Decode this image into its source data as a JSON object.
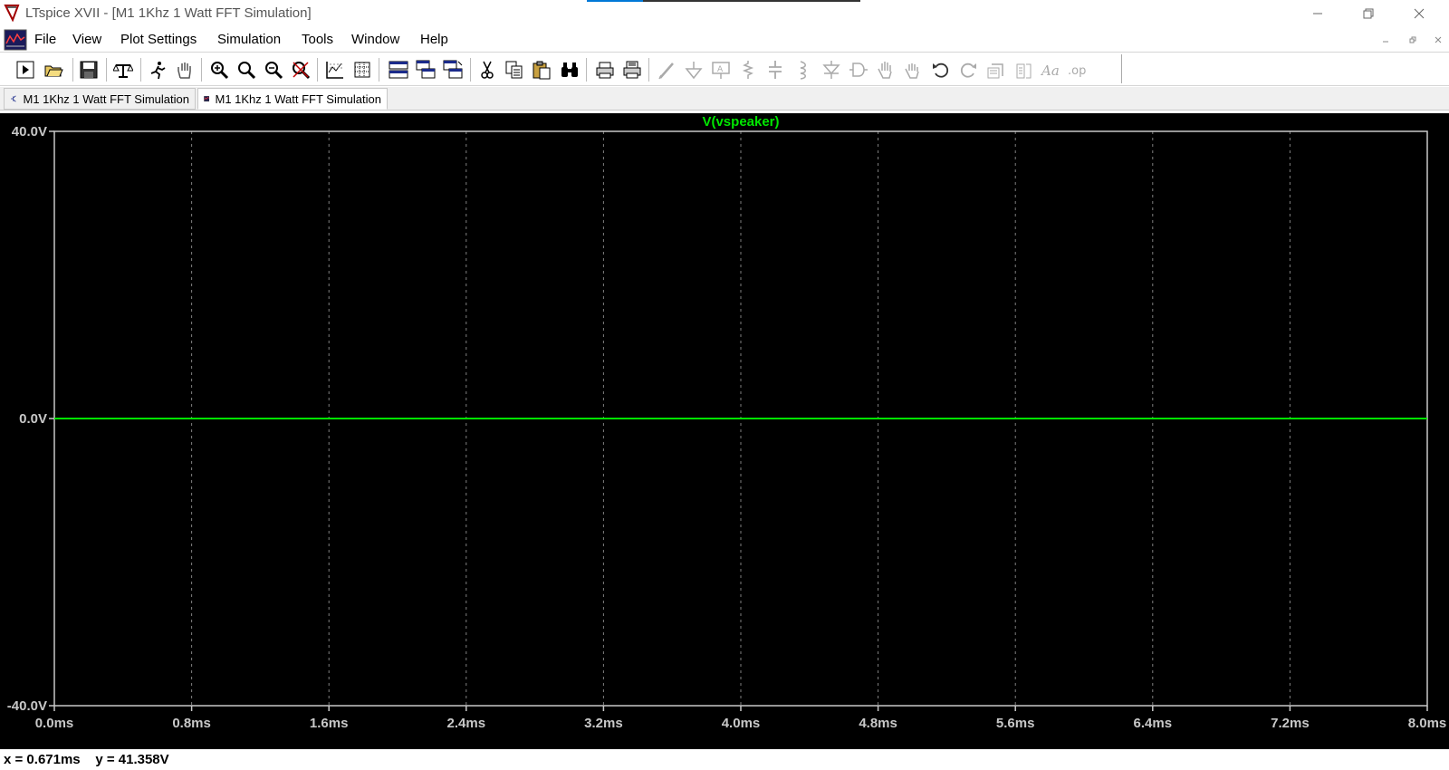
{
  "window": {
    "title": "LTspice XVII - [M1 1Khz 1 Watt FFT Simulation]"
  },
  "menu": {
    "items": [
      "File",
      "View",
      "Plot Settings",
      "Simulation",
      "Tools",
      "Window",
      "Help"
    ]
  },
  "toolbar": {
    "icons": [
      "run-icon",
      "open-icon",
      "save-icon",
      "control-panel-icon",
      "run-stop-icon",
      "pan-hand-icon",
      "zoom-in-icon",
      "zoom-out-icon",
      "zoom-back-icon",
      "zoom-cancel-icon",
      "autorange-icon",
      "grid-icon",
      "tile-horizontal-icon",
      "cascade-icon",
      "tile-vertical-icon",
      "cut-icon",
      "copy-icon",
      "paste-icon",
      "find-icon",
      "print-icon",
      "print-setup-icon",
      "wire-icon",
      "ground-icon",
      "label-icon",
      "resistor-icon",
      "capacitor-icon",
      "inductor-icon",
      "diode-icon",
      "component-icon",
      "move-icon",
      "drag-icon",
      "undo-icon",
      "redo-icon",
      "rotate-icon",
      "mirror-icon",
      "text-icon",
      "spice-directive-icon"
    ]
  },
  "tabs": [
    {
      "label": "M1 1Khz 1 Watt FFT Simulation",
      "kind": "schematic"
    },
    {
      "label": "M1 1Khz 1 Watt FFT Simulation",
      "kind": "waveform"
    }
  ],
  "status": {
    "cursor": "x = 0.671ms    y = 41.358V"
  },
  "colors": {
    "plot_background": "#000000",
    "trace": "#00e600",
    "grid": "#808080",
    "axis": "#c8c8c8"
  },
  "chart_data": {
    "type": "line",
    "title": "",
    "series": [
      {
        "name": "V(vspeaker)",
        "x": [
          0.0,
          8.0
        ],
        "y": [
          0.0,
          0.0
        ]
      }
    ],
    "xlim": [
      0.0,
      8.0
    ],
    "ylim": [
      -40.0,
      40.0
    ],
    "xticks": [
      0.0,
      0.8,
      1.6,
      2.4,
      3.2,
      4.0,
      4.8,
      5.6,
      6.4,
      7.2,
      8.0
    ],
    "xtick_labels": [
      "0.0ms",
      "0.8ms",
      "1.6ms",
      "2.4ms",
      "3.2ms",
      "4.0ms",
      "4.8ms",
      "5.6ms",
      "6.4ms",
      "7.2ms",
      "8.0ms"
    ],
    "yticks": [
      40.0,
      0.0,
      -40.0
    ],
    "ytick_labels": [
      "40.0V",
      "0.0V",
      "-40.0V"
    ],
    "grid": true,
    "legend": "top-center"
  }
}
